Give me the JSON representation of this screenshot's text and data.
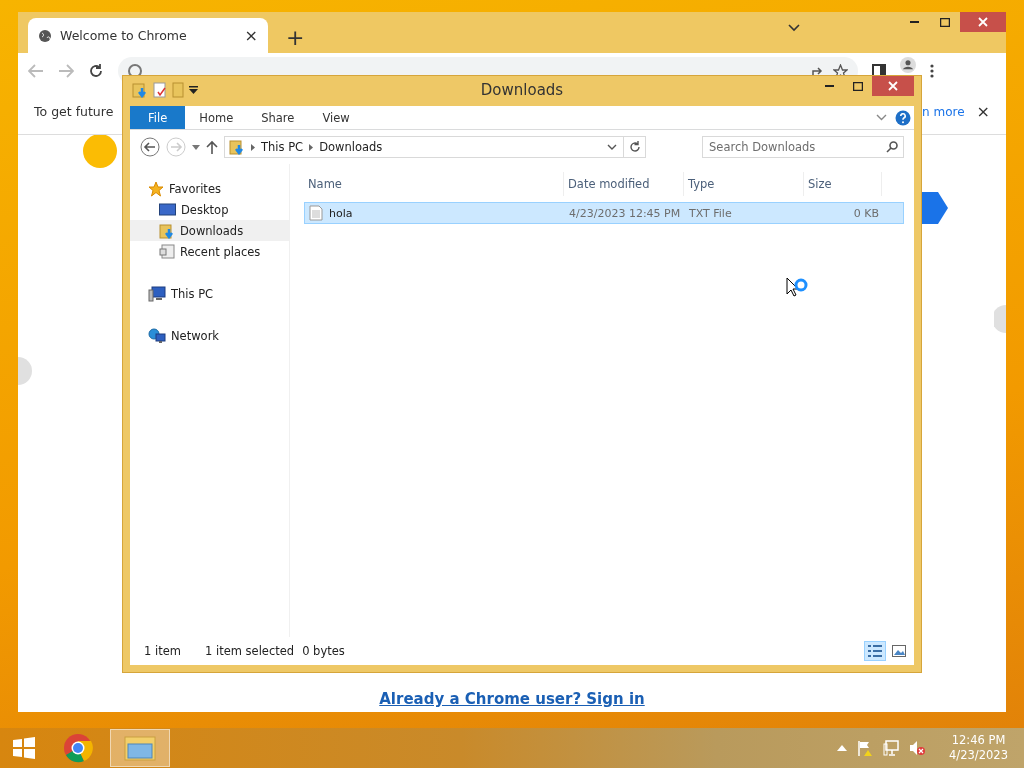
{
  "chrome": {
    "tab": {
      "title": "Welcome to Chrome",
      "selected": true,
      "close": "×"
    },
    "new_tab": "+",
    "infobar": {
      "text": "To get future",
      "link": "n more",
      "close": "×"
    },
    "sign_in_link": "Already a Chrome user? Sign in"
  },
  "explorer": {
    "title": "Downloads",
    "ribbon_tabs": [
      {
        "label": "File",
        "selected": true
      },
      {
        "label": "Home",
        "selected": false
      },
      {
        "label": "Share",
        "selected": false
      },
      {
        "label": "View",
        "selected": false
      }
    ],
    "breadcrumb": [
      "This PC",
      "Downloads"
    ],
    "search": {
      "placeholder": "Search Downloads"
    },
    "nav": [
      {
        "label": "Favorites",
        "kind": "star",
        "selected": false,
        "children": [
          {
            "label": "Desktop",
            "kind": "desktop",
            "selected": false
          },
          {
            "label": "Downloads",
            "kind": "downloads",
            "selected": true
          },
          {
            "label": "Recent places",
            "kind": "recent",
            "selected": false
          }
        ]
      },
      {
        "label": "This PC",
        "kind": "pc",
        "selected": false
      },
      {
        "label": "Network",
        "kind": "network",
        "selected": false
      }
    ],
    "columns": [
      "Name",
      "Date modified",
      "Type",
      "Size"
    ],
    "rows": [
      {
        "name": "hola",
        "date": "4/23/2023 12:45 PM",
        "type": "TXT File",
        "size": "0 KB",
        "selected": true
      }
    ],
    "status": {
      "count": "1 item",
      "selection": "1 item selected",
      "size": "0 bytes"
    },
    "views": [
      {
        "kind": "details",
        "selected": true
      },
      {
        "kind": "tiles",
        "selected": false
      }
    ]
  },
  "taskbar": {
    "apps": [
      {
        "kind": "chrome",
        "active": false
      },
      {
        "kind": "explorer",
        "active": true
      }
    ],
    "clock": {
      "time": "12:46 PM",
      "date": "4/23/2023"
    }
  }
}
